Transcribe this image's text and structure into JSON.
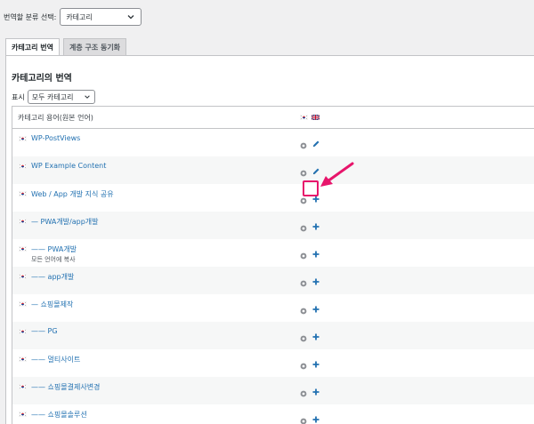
{
  "header": {
    "select_label": "번역할 분류 선택:",
    "select_value": "카테고리"
  },
  "tabs": [
    {
      "label": "카테고리 번역",
      "active": true
    },
    {
      "label": "계층 구조 동기화",
      "active": false
    }
  ],
  "panel": {
    "title": "카테고리의 번역",
    "display_label": "표시",
    "display_value": "모두 카테고리"
  },
  "table": {
    "column_header": "카테고리 용어(원본 언어)",
    "languages": [
      "ko-flag-icon",
      "gb-flag-icon"
    ],
    "rows": [
      {
        "name": "WP-PostViews",
        "action": "pencil-icon"
      },
      {
        "name": "WP Example Content",
        "action": "pencil-icon"
      },
      {
        "name": "Web / App 개발 지식 공유",
        "action": "plus-icon",
        "highlighted": true
      },
      {
        "name": "— PWA개발/app개발",
        "action": "plus-icon"
      },
      {
        "name": "—— PWA개발",
        "sub": "모든 언어에 복사",
        "action": "plus-icon"
      },
      {
        "name": "—— app개발",
        "action": "plus-icon"
      },
      {
        "name": "— 쇼핑몰제작",
        "action": "plus-icon"
      },
      {
        "name": "—— PG",
        "action": "plus-icon"
      },
      {
        "name": "—— 멀티사이트",
        "action": "plus-icon"
      },
      {
        "name": "—— 쇼핑몰결제사변경",
        "action": "plus-icon"
      },
      {
        "name": "—— 쇼핑몰솔루션",
        "action": "plus-icon"
      }
    ]
  },
  "colors": {
    "link": "#2271b1",
    "highlight": "#e7156b"
  }
}
